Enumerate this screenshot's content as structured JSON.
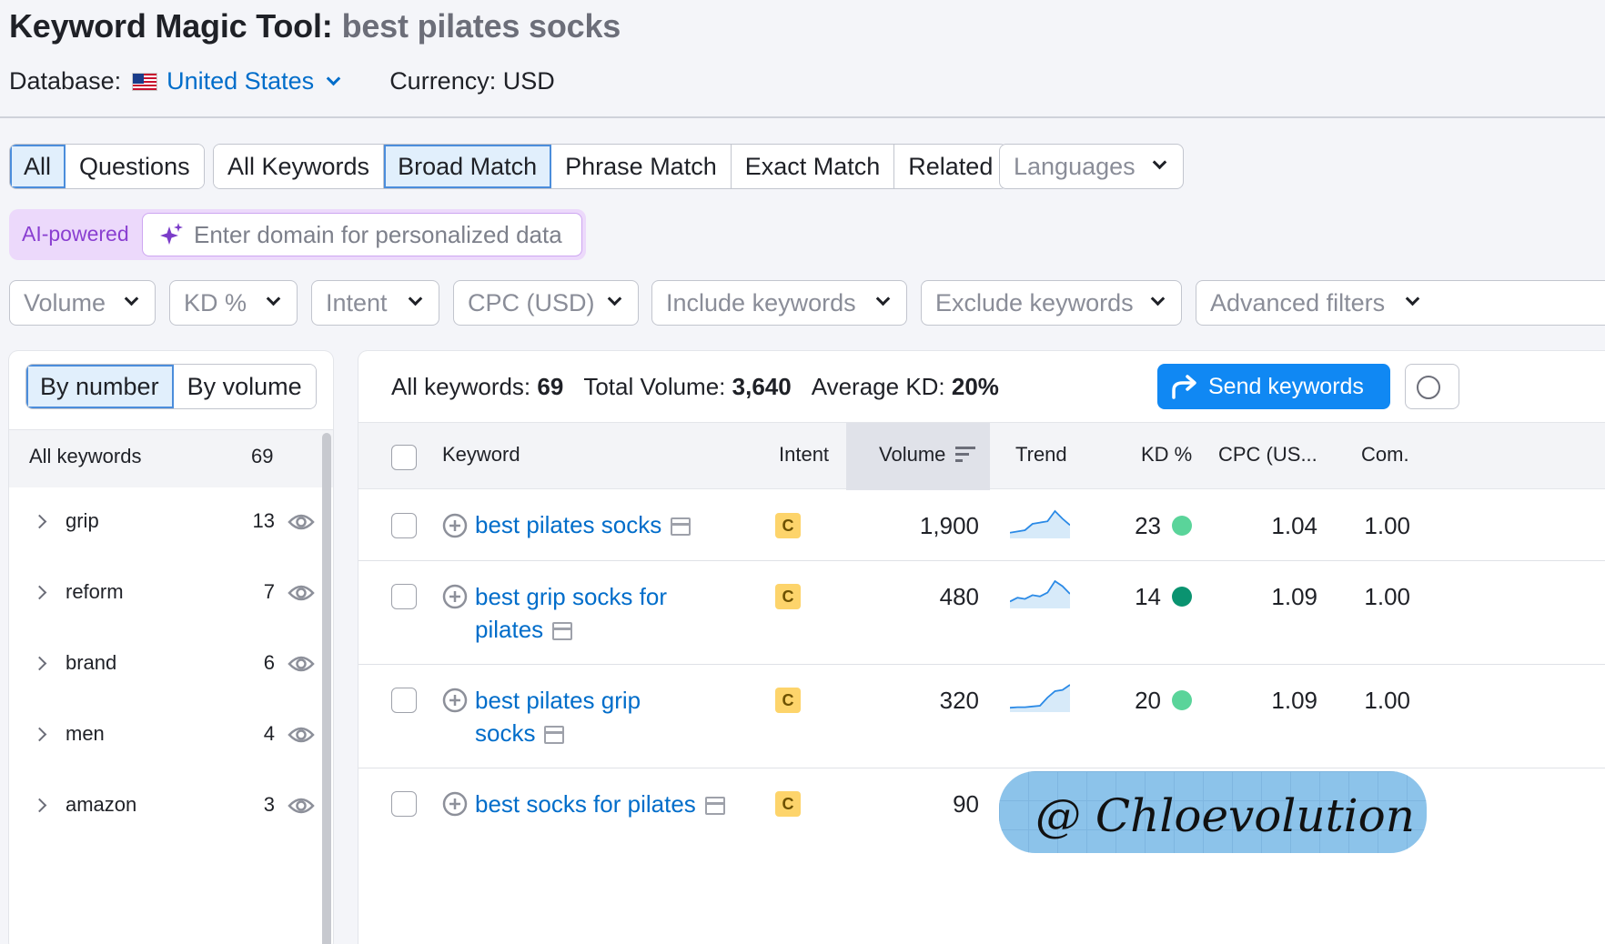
{
  "header": {
    "title": "Keyword Magic Tool:",
    "query": "best pilates socks",
    "database_label": "Database:",
    "database_value": "United States",
    "currency": "Currency: USD"
  },
  "tabs_group1": [
    "All",
    "Questions"
  ],
  "tabs_group2": [
    "All Keywords",
    "Broad Match",
    "Phrase Match",
    "Exact Match",
    "Related"
  ],
  "languages": "Languages",
  "ai": {
    "label": "AI-powered",
    "placeholder": "Enter domain for personalized data"
  },
  "filters": [
    "Volume",
    "KD %",
    "Intent",
    "CPC (USD)",
    "Include keywords",
    "Exclude keywords",
    "Advanced filters"
  ],
  "left_panel": {
    "toggle": [
      "By number",
      "By volume"
    ],
    "all_label": "All keywords",
    "all_count": "69",
    "groups": [
      {
        "name": "grip",
        "count": "13"
      },
      {
        "name": "reform",
        "count": "7"
      },
      {
        "name": "brand",
        "count": "6"
      },
      {
        "name": "men",
        "count": "4"
      },
      {
        "name": "amazon",
        "count": "3"
      }
    ]
  },
  "summary": {
    "all_keywords_label": "All keywords:",
    "all_keywords_value": "69",
    "total_volume_label": "Total Volume:",
    "total_volume_value": "3,640",
    "avg_kd_label": "Average KD:",
    "avg_kd_value": "20%"
  },
  "send_button": "Send keywords",
  "columns": [
    "Keyword",
    "Intent",
    "Volume",
    "Trend",
    "KD %",
    "CPC (US...",
    "Com."
  ],
  "rows": [
    {
      "keyword_line1": "best pilates socks",
      "keyword_line2": "",
      "intent": "C",
      "volume": "1,900",
      "kd": "23",
      "kd_color": "#5ad49a",
      "cpc": "1.04",
      "com": "1.00",
      "trend": [
        0.15,
        0.2,
        0.25,
        0.5,
        0.55,
        0.6,
        1.0,
        0.7,
        0.45
      ]
    },
    {
      "keyword_line1": "best grip socks for",
      "keyword_line2": "pilates",
      "intent": "C",
      "volume": "480",
      "kd": "14",
      "kd_color": "#0a9370",
      "cpc": "1.09",
      "com": "1.00",
      "trend": [
        0.2,
        0.35,
        0.3,
        0.45,
        0.4,
        0.55,
        1.0,
        0.8,
        0.5
      ]
    },
    {
      "keyword_line1": "best pilates grip",
      "keyword_line2": "socks",
      "intent": "C",
      "volume": "320",
      "kd": "20",
      "kd_color": "#5ad49a",
      "cpc": "1.09",
      "com": "1.00",
      "trend": [
        0.1,
        0.12,
        0.12,
        0.15,
        0.18,
        0.5,
        0.75,
        0.8,
        1.0
      ]
    },
    {
      "keyword_line1": "best socks for pilates",
      "keyword_line2": "",
      "intent": "C",
      "volume": "90",
      "kd": "",
      "kd_color": "",
      "cpc": "",
      "com": "",
      "trend": []
    }
  ],
  "watermark": "@ Chloevolution",
  "colors": {
    "accent": "#006dca",
    "primary_button": "#1088f3",
    "ai_purple": "#8a3fd1"
  }
}
